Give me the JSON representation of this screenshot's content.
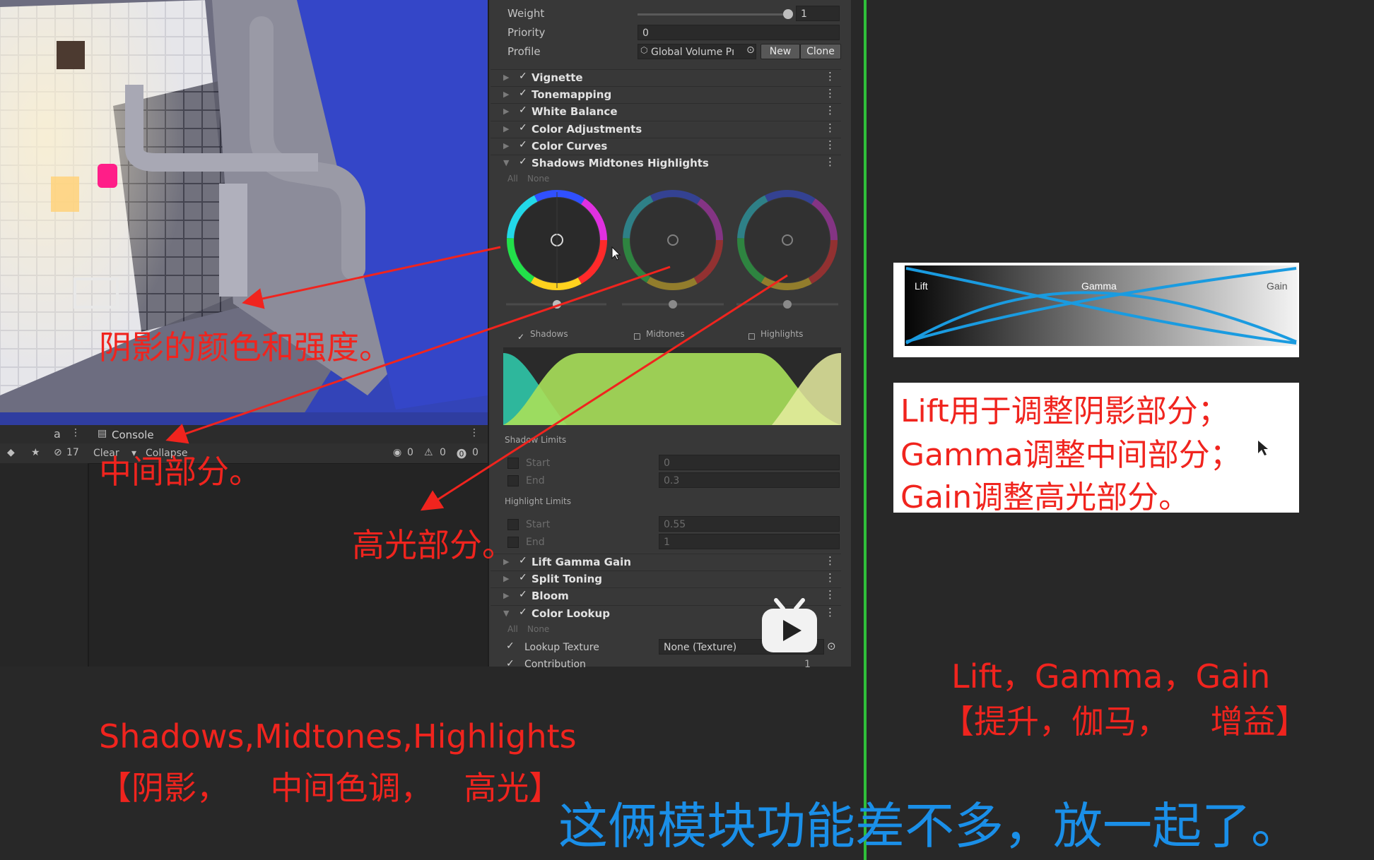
{
  "inspector": {
    "weight_label": "Weight",
    "weight_value": "1",
    "priority_label": "Priority",
    "priority_value": "0",
    "profile_label": "Profile",
    "profile_value": "Global Volume Pı",
    "new_button": "New",
    "clone_button": "Clone",
    "components": [
      {
        "name": "Vignette",
        "expanded": false
      },
      {
        "name": "Tonemapping",
        "expanded": false
      },
      {
        "name": "White Balance",
        "expanded": false
      },
      {
        "name": "Color Adjustments",
        "expanded": false
      },
      {
        "name": "Color Curves",
        "expanded": false
      },
      {
        "name": "Shadows Midtones Highlights",
        "expanded": true
      }
    ],
    "all_label": "All",
    "none_label": "None",
    "wheels": [
      {
        "label": "Shadows",
        "checked": true
      },
      {
        "label": "Midtones",
        "checked": false
      },
      {
        "label": "Highlights",
        "checked": false
      }
    ],
    "shadow_limits": {
      "title": "Shadow Limits",
      "start_label": "Start",
      "start_value": "0",
      "end_label": "End",
      "end_value": "0.3"
    },
    "highlight_limits": {
      "title": "Highlight Limits",
      "start_label": "Start",
      "start_value": "0.55",
      "end_label": "End",
      "end_value": "1"
    },
    "components2": [
      {
        "name": "Lift Gamma Gain",
        "expanded": false
      },
      {
        "name": "Split Toning",
        "expanded": false
      },
      {
        "name": "Bloom",
        "expanded": false
      },
      {
        "name": "Color Lookup",
        "expanded": true
      }
    ],
    "lookup_texture_label": "Lookup Texture",
    "lookup_texture_value": "None (Texture)",
    "contribution_label": "Contribution",
    "contribution_value": "1"
  },
  "console": {
    "tab_label": "Console",
    "clear_label": "Clear",
    "collapse_label": "Collapse",
    "hidden_count": "17",
    "log_count": "0",
    "warning_count": "0",
    "error_count": "0"
  },
  "annotations": {
    "shadow_note": "阴影的颜色和强度。",
    "mid_note": "中间部分。",
    "high_note": "高光部分。",
    "smh_title": "Shadows,Midtones,Highlights",
    "smh_cn": "【阴影，    中间色调，   高光】",
    "lgg_line1": "Lift用于调整阴影部分；",
    "lgg_line2": "Gamma调整中间部分；",
    "lgg_line3": "Gain调整高光部分。",
    "lgg_title": "Lift，Gamma，Gain",
    "lgg_cn": "【提升，伽马，    增益】",
    "subtitle": "这俩模块功能差不多，放一起了。"
  },
  "lgg_graph": {
    "lift_label": "Lift",
    "gamma_label": "Gamma",
    "gain_label": "Gain"
  },
  "colors": {
    "annotation_red": "#f0241e",
    "subtitle_blue": "#1a8fe8",
    "divider_green": "#2fbf3a",
    "curve_blue": "#1a9be0"
  }
}
